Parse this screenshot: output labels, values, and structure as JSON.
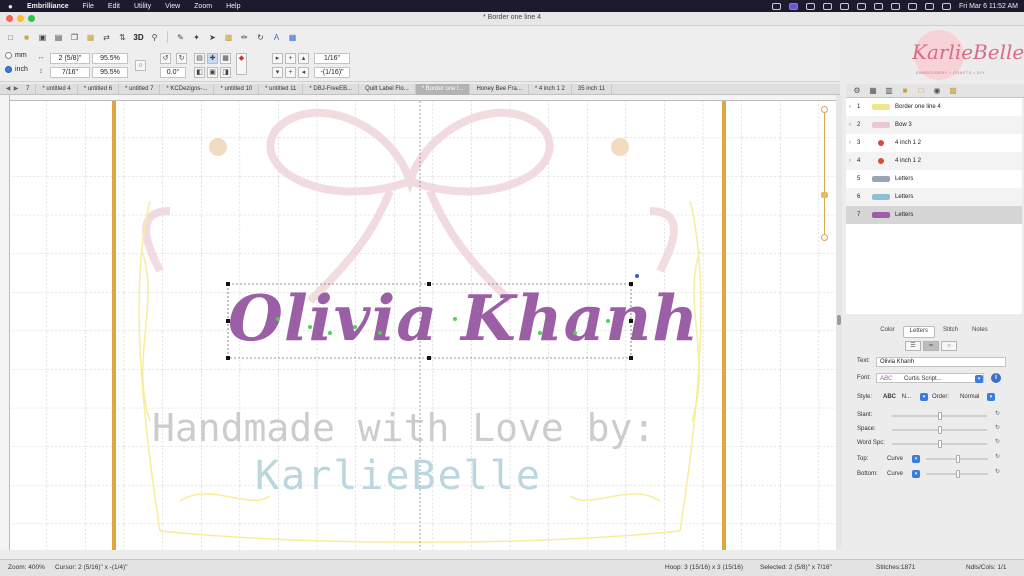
{
  "menubar": {
    "app_name": "Embrilliance",
    "items": [
      "File",
      "Edit",
      "Utility",
      "View",
      "Zoom",
      "Help"
    ],
    "clock": "Fri Mar 6  11:52 AM"
  },
  "window": {
    "title": "* Border one line 4"
  },
  "toolbar": {
    "label_3d": "3D",
    "unit_mm": "mm",
    "unit_inch": "inch",
    "width_value": "2 (5/8)\"",
    "width_percent": "95.5%",
    "height_value": "7/16\"",
    "height_percent": "95.5%",
    "rotation": "0.0°",
    "nudge_value": "1/16\"",
    "offset_value": "-(1/16)\""
  },
  "logo": {
    "main": "KarlieBelle",
    "sub": "EMBROIDERY • CRAFTS • DIY"
  },
  "tabs": [
    "7",
    "* untitled 4",
    "* untitled 6",
    "* untitled 7",
    "* KCDezigns-...",
    "* untitled 10",
    "* untitled 11",
    "* DBJ-FreeEB...",
    "Quilt Label Flo...",
    "* Border one l...",
    "Honey Bee Fra...",
    "* 4 inch 1 2",
    "35 inch 11"
  ],
  "active_tab_index": 9,
  "canvas": {
    "design_text": "Olivia Khanh",
    "bg_text_1": "Handmade with Love by:",
    "bg_text_2": "KarlieBelle"
  },
  "layers": [
    {
      "num": "1",
      "name": "Border one line 4",
      "thumb": "#f2e58a",
      "expandable": true
    },
    {
      "num": "2",
      "name": "Bow 3",
      "thumb": "#e9c8cf",
      "expandable": true
    },
    {
      "num": "3",
      "name": "4 inch 1 2",
      "thumb": "#d94a3a",
      "expandable": true,
      "dot": true
    },
    {
      "num": "4",
      "name": "4 inch 1 2",
      "thumb": "#d94a3a",
      "expandable": true,
      "dot": true
    },
    {
      "num": "5",
      "name": "Letters",
      "thumb": "#9aa4b4",
      "expandable": false
    },
    {
      "num": "6",
      "name": "Letters",
      "thumb": "#8fc1d3",
      "expandable": false
    },
    {
      "num": "7",
      "name": "Letters",
      "thumb": "#9b5fa5",
      "expandable": false
    }
  ],
  "properties": {
    "tabs": [
      "Color",
      "Letters",
      "Stitch",
      "Notes"
    ],
    "active_tab": "Letters",
    "text_label": "Text:",
    "text_value": "Olivia Khanh",
    "font_label": "Font:",
    "font_preview": "ABC",
    "font_value": "Curtis Script...",
    "style_label": "Style:",
    "style_preview": "ABC",
    "style_value": "N...",
    "order_label": "Order:",
    "order_value": "Normal",
    "slant_label": "Slant:",
    "space_label": "Space:",
    "word_spc_label": "Word Spc:",
    "top_label": "Top:",
    "top_value": "Curve",
    "bottom_label": "Bottom:",
    "bottom_value": "Curve"
  },
  "status": {
    "zoom": "Zoom: 400%",
    "cursor": "Cursor: 2 (5/16)\" x -(1/4)\"",
    "hoop": "Hoop: 3 (15/16) x 3 (15/16)",
    "selected": "Selected: 2 (5/8)\" x 7/16\"",
    "stitches": "Stitches:1871",
    "ndls": "Ndls/Cols: 1/1"
  },
  "colors": {
    "design_purple": "#9b5fa5",
    "border_gold": "#e0a640",
    "accent_blue": "#3a7be0"
  }
}
